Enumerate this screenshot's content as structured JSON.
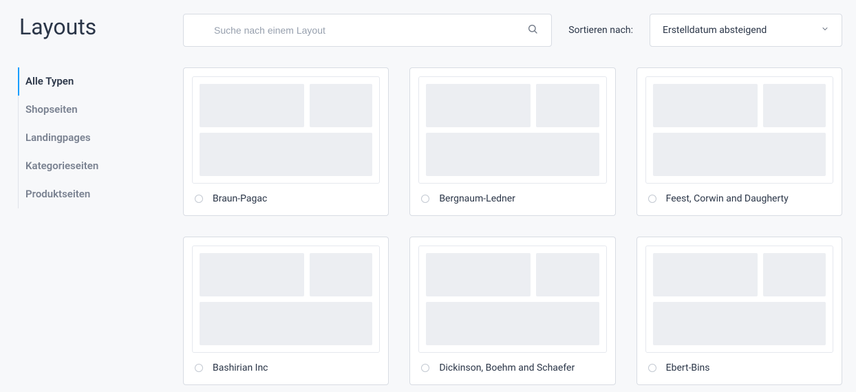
{
  "page": {
    "title": "Layouts"
  },
  "sidebar": {
    "items": [
      {
        "label": "Alle Typen",
        "active": true
      },
      {
        "label": "Shopseiten",
        "active": false
      },
      {
        "label": "Landingpages",
        "active": false
      },
      {
        "label": "Kategorieseiten",
        "active": false
      },
      {
        "label": "Produktseiten",
        "active": false
      }
    ]
  },
  "toolbar": {
    "search_placeholder": "Suche nach einem Layout",
    "sort_label": "Sortieren nach:",
    "sort_value": "Erstelldatum absteigend"
  },
  "cards": [
    {
      "name": "Braun-Pagac"
    },
    {
      "name": "Bergnaum-Ledner"
    },
    {
      "name": "Feest, Corwin and Daugherty"
    },
    {
      "name": "Bashirian Inc"
    },
    {
      "name": "Dickinson, Boehm and Schaefer"
    },
    {
      "name": "Ebert-Bins"
    }
  ]
}
